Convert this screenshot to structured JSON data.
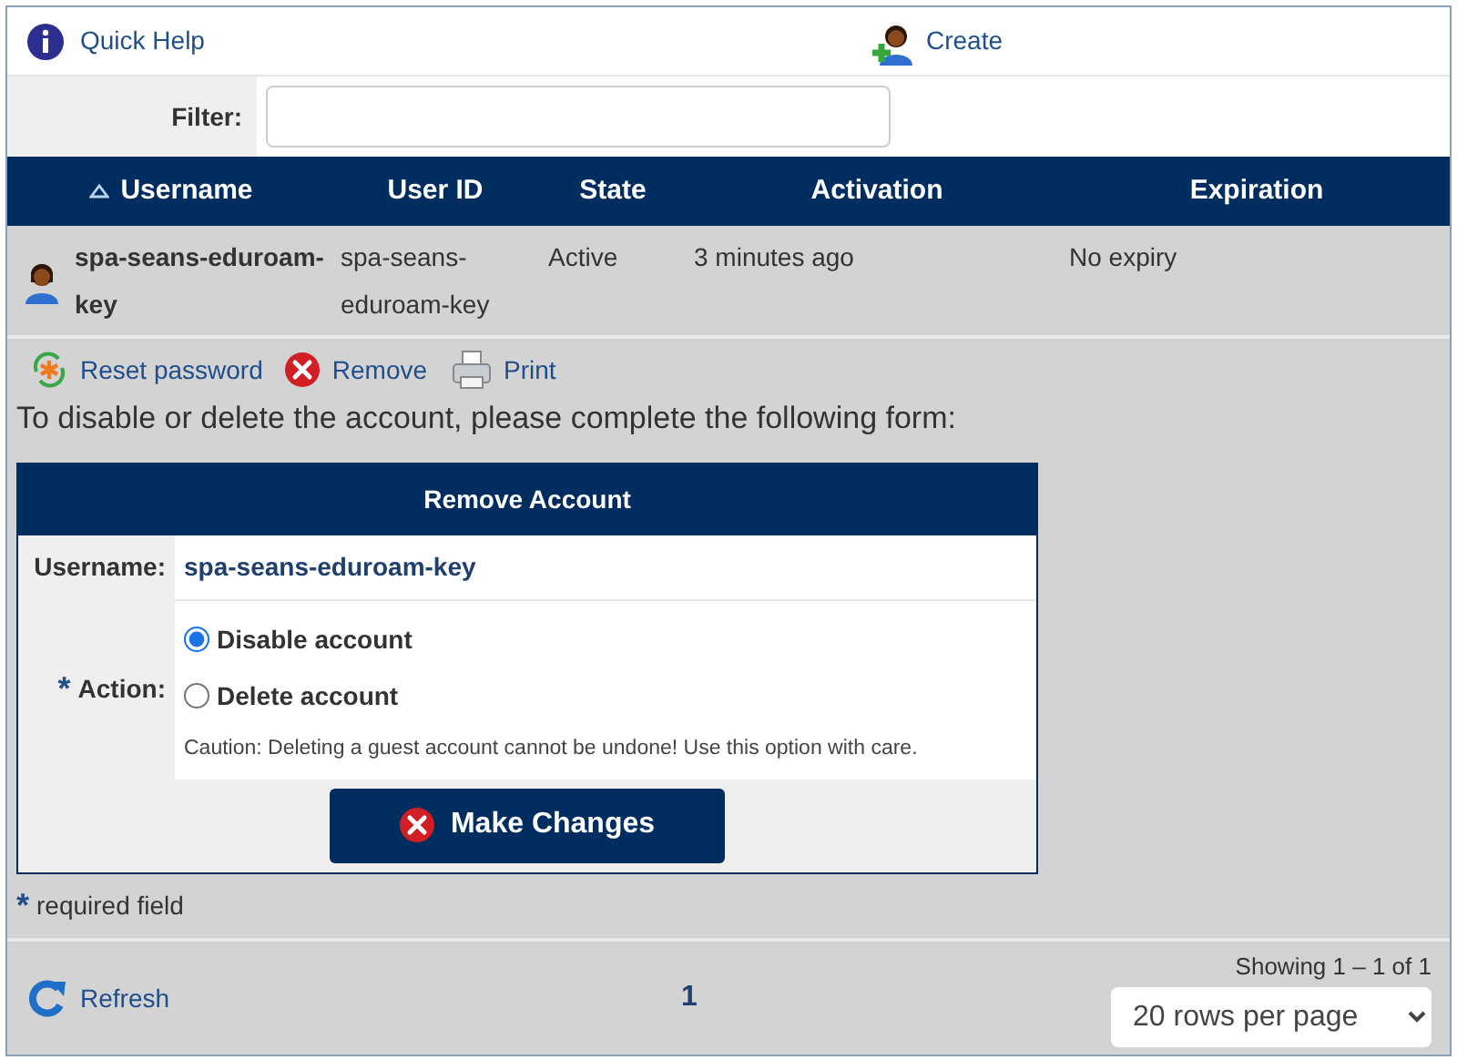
{
  "toolbar": {
    "help": "Quick Help",
    "create": "Create"
  },
  "filter": {
    "label": "Filter:"
  },
  "table": {
    "columns": [
      {
        "label": "Username",
        "sorted": true
      },
      {
        "label": "User ID",
        "sorted": false
      },
      {
        "label": "State",
        "sorted": false
      },
      {
        "label": "Activation",
        "sorted": false
      },
      {
        "label": "Expiration",
        "sorted": false
      }
    ],
    "rows": [
      {
        "username": "spa-seans-eduroam-key",
        "user_id": "spa-seans-eduroam-key",
        "state": "Active",
        "activation": "3 minutes ago",
        "expiration": "No expiry"
      }
    ]
  },
  "actions": [
    {
      "kind": "reset",
      "label": "Reset password"
    },
    {
      "kind": "remove",
      "label": "Remove"
    },
    {
      "kind": "print",
      "label": "Print"
    }
  ],
  "instructions": "To disable or delete the account, please complete the following form:",
  "form": {
    "title": "Remove Account",
    "username_label": "Username:",
    "username": "spa-seans-eduroam-key",
    "required_mark": "*",
    "action_label": "Action:",
    "options": [
      {
        "label": "Disable account",
        "selected": true
      },
      {
        "label": "Delete account",
        "selected": false
      }
    ],
    "caution": "Caution: Deleting a guest account cannot be undone! Use this option with care.",
    "submit": "Make Changes"
  },
  "required_note": {
    "mark": "*",
    "text": "required field"
  },
  "footer": {
    "refresh": "Refresh",
    "page": "1",
    "showing": "Showing 1 – 1 of 1",
    "rows_per_page": "20 rows per page"
  }
}
